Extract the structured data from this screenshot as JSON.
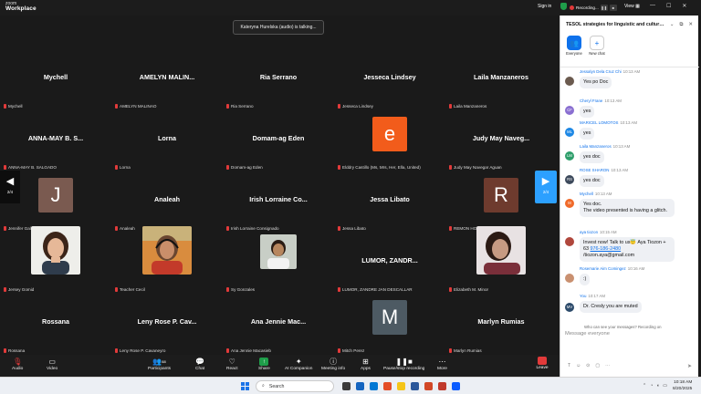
{
  "app": {
    "brand": "zoom",
    "product": "Workplace",
    "sign_in": "Sign in",
    "recording": "Recording...",
    "view": "View",
    "window_controls": [
      "—",
      "☐",
      "✕"
    ]
  },
  "toast": "Kateryna Hurelska (audio) is talking...",
  "nav": {
    "left_page": "2/4",
    "right_page": "2/4"
  },
  "tiles": [
    {
      "name": "Mychell",
      "label": "Mychell"
    },
    {
      "name": "AMELYN MALIN...",
      "label": "AMELYN MALINAO"
    },
    {
      "name": "Ria Serrano",
      "label": "Ria Serrano"
    },
    {
      "name": "Jesseca Lindsey",
      "label": "Jesseca Lindsey"
    },
    {
      "name": "Laila Manzaneros",
      "label": "Laila Manzaneros"
    },
    {
      "name": "ANNA-MAY B. S...",
      "label": "ANNA-MAY B. SALGADO"
    },
    {
      "name": "Lorna",
      "label": "Lorna"
    },
    {
      "name": "Domam-ag Eden",
      "label": "Domam-ag Eden"
    },
    {
      "avatar": "e",
      "avatar_color": "#f25c1b",
      "label": "Elddry Castillo (Ms, Mrs, Her, Ella, United)"
    },
    {
      "name": "Judy May Naveg...",
      "label": "Judy May Navegar Aguan"
    },
    {
      "avatar": "J",
      "avatar_color": "#7a5a50",
      "label": "Jennifer Galang"
    },
    {
      "name": "Analeah",
      "label": "Analeah"
    },
    {
      "name": "Irish Lorraine Co...",
      "label": "Irish Lorraine Consignado"
    },
    {
      "name": "Jessa Libato",
      "label": "Jessa Libato"
    },
    {
      "avatar": "R",
      "avatar_color": "#6e3b2e",
      "label": "REMON HOGMON_Senior HS"
    },
    {
      "photo": "woman-portrait",
      "label": "Jersey Gomid"
    },
    {
      "photo": "teacher-headset",
      "label": "Teacher Cecil"
    },
    {
      "photo": "man-portrait",
      "label": "Sy Gonzales"
    },
    {
      "name": "LUMOR, ZANDR...",
      "label": "LUMOR, ZANDRE JAN DESCALLAR"
    },
    {
      "photo": "woman-selfie",
      "label": "Elizabeth M. Minor"
    },
    {
      "name": "Rossana",
      "label": "Rossana"
    },
    {
      "name": "Leny Rose P. Cav...",
      "label": "Leny Rose P. Cavaneyro"
    },
    {
      "name": "Ana Jennie Mac...",
      "label": "Ana Jennie Macasieb"
    },
    {
      "avatar": "M",
      "avatar_color": "#4d5a63",
      "label": "Mitch Perez"
    },
    {
      "name": "Marlyn Rumias",
      "label": "Marlyn Rumias"
    }
  ],
  "toolbar": {
    "audio": "Audio",
    "video": "Video",
    "participants": "Participants",
    "participants_count": "88",
    "chat": "Chat",
    "react": "React",
    "share": "Share",
    "ai": "AI Companion",
    "meeting_info": "Meeting info",
    "apps": "Apps",
    "record": "Pause/stop recording",
    "more": "More",
    "leave": "Leave"
  },
  "chat": {
    "title": "TESOL strategies for linguistic and cultural...",
    "tab_everyone": "Everyone",
    "tab_new": "New chat",
    "messages": [
      {
        "name": "Jessalyn Dela Cruz Chi",
        "time": "10:13 AM",
        "text": "Yes po Doc",
        "initials": "",
        "color": "#6b5a4e"
      },
      {
        "name": "Cheryl Frane",
        "time": "10:13 AM",
        "text": "yes",
        "initials": "CF",
        "color": "#8a6fd1"
      },
      {
        "name": "MARICEL LOMOTOS",
        "time": "10:13 AM",
        "text": "yes",
        "initials": "ML",
        "color": "#1e88e5"
      },
      {
        "name": "Laila Manzaneros",
        "time": "10:13 AM",
        "text": "yes doc",
        "initials": "LM",
        "color": "#2e9e6b"
      },
      {
        "name": "ROSE SHARON",
        "time": "10:13 AM",
        "text": "yes doc",
        "initials": "RS",
        "color": "#3d4a5c"
      },
      {
        "name": "Mychell",
        "time": "10:13 AM",
        "text": "Yes doc.\nThe video presented is having a glitch.",
        "initials": "M",
        "color": "#f06a2a"
      },
      {
        "name": "aya tiozon",
        "time": "10:15 AM",
        "text_a": "Invest now! Talk to us😇 Aya Tiozon + 63 ",
        "link": "976-186-2480",
        "text_b": " /tiozon.aya@gmail.com",
        "initials": "",
        "color": "#b0473c"
      },
      {
        "name": "Rosemarie Aim Comingez",
        "time": "10:16 AM",
        "text": ":)",
        "initials": "",
        "color": "#c99070"
      },
      {
        "name": "You",
        "time": "10:17 AM",
        "text": "Dr. Cresly you are muted",
        "initials": "MV",
        "color": "#2d4b6b"
      }
    ],
    "who_can_see": "Who can see your messages? Recording on",
    "input_placeholder": "Message everyone"
  },
  "taskbar": {
    "search": "Search",
    "time": "10:18 AM",
    "date": "8/20/2025"
  }
}
